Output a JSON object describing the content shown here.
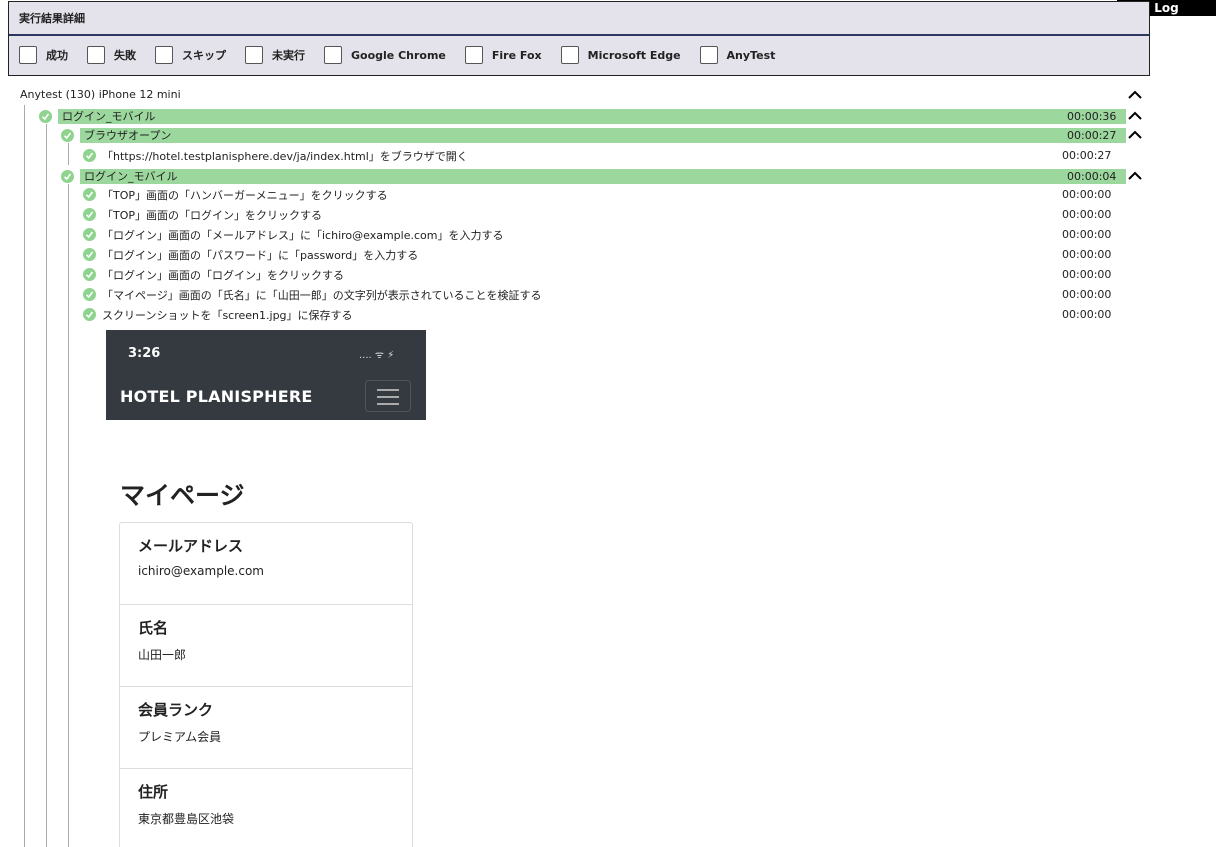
{
  "log_tab": "Log",
  "panel": {
    "title": "実行結果詳細",
    "filters": [
      "成功",
      "失敗",
      "スキップ",
      "未実行",
      "Google Chrome",
      "Fire Fox",
      "Microsoft Edge",
      "AnyTest"
    ]
  },
  "root": {
    "label": "Anytest (130) iPhone 12 mini"
  },
  "groups": [
    {
      "label": "ログイン_モバイル",
      "time": "00:00:36"
    },
    {
      "label": "ブラウザオープン",
      "time": "00:00:27"
    },
    {
      "label": "ログイン_モバイル",
      "time": "00:00:04"
    }
  ],
  "steps": [
    {
      "label": "「https://hotel.testplanisphere.dev/ja/index.html」をブラウザで開く",
      "time": "00:00:27"
    },
    {
      "label": "「TOP」画面の「ハンバーガーメニュー」をクリックする",
      "time": "00:00:00"
    },
    {
      "label": "「TOP」画面の「ログイン」をクリックする",
      "time": "00:00:00"
    },
    {
      "label": "「ログイン」画面の「メールアドレス」に「ichiro@example.com」を入力する",
      "time": "00:00:00"
    },
    {
      "label": "「ログイン」画面の「パスワード」に「password」を入力する",
      "time": "00:00:00"
    },
    {
      "label": "「ログイン」画面の「ログイン」をクリックする",
      "time": "00:00:00"
    },
    {
      "label": "「マイページ」画面の「氏名」に「山田一郎」の文字列が表示されていることを検証する",
      "time": "00:00:00"
    },
    {
      "label": "スクリーンショットを「screen1.jpg」に保存する",
      "time": "00:00:00"
    }
  ],
  "screenshot": {
    "clock": "3:26",
    "status": ".... ᯤ ⚡",
    "brand": "HOTEL PLANISPHERE",
    "page_title": "マイページ",
    "fields": [
      {
        "label": "メールアドレス",
        "value": "ichiro@example.com"
      },
      {
        "label": "氏名",
        "value": "山田一郎"
      },
      {
        "label": "会員ランク",
        "value": "プレミアム会員"
      },
      {
        "label": "住所",
        "value": "東京都豊島区池袋"
      }
    ]
  },
  "colors": {
    "success": "#9cd89e",
    "panel_bg": "#e4e3ec",
    "accent_line": "#2b3760"
  }
}
